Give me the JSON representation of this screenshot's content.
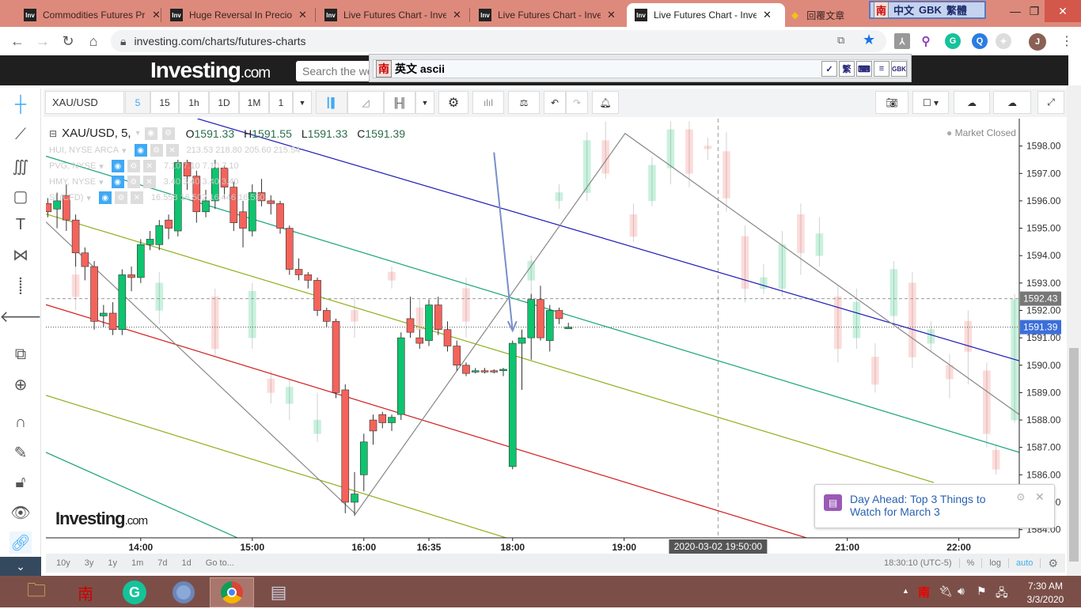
{
  "browser": {
    "tabs": [
      {
        "title": "Commodities Futures Prices",
        "favicon": "Inv"
      },
      {
        "title": "Huge Reversal In Precious",
        "favicon": "Inv"
      },
      {
        "title": "Live Futures Chart - Investing",
        "favicon": "Inv"
      },
      {
        "title": "Live Futures Chart - Investing",
        "favicon": "Inv"
      },
      {
        "title": "Live Futures Chart - Investing",
        "favicon": "Inv",
        "active": true
      },
      {
        "title": "回覆文章",
        "favicon": "gem"
      }
    ],
    "ime_status": {
      "logo": "南",
      "mode": "中文",
      "charset": "GBK",
      "script": "繁體"
    },
    "url": "investing.com/charts/futures-charts",
    "profile_initial": "J"
  },
  "site": {
    "logo_main": "Investing",
    "logo_suffix": ".com",
    "search_placeholder": "Search the website..."
  },
  "ime_bar": {
    "logo": "南",
    "text": "英文 ascii",
    "buttons": [
      "✓",
      "繁",
      "⌨",
      "≡",
      "GBK"
    ]
  },
  "toolbar": {
    "symbol": "XAU/USD",
    "intervals": [
      "5",
      "15",
      "1h",
      "1D",
      "1M",
      "1"
    ],
    "active_interval": "5"
  },
  "legend": {
    "main": {
      "symbol": "XAU/USD, 5,",
      "o_label": "O",
      "o": "1591.33",
      "h_label": "H",
      "h": "1591.55",
      "l_label": "L",
      "l": "1591.33",
      "c_label": "C",
      "c": "1591.39"
    },
    "overlays": [
      {
        "name": "HUI, NYSE ARCA",
        "values": "213.53  218.80  205.60  215.54"
      },
      {
        "name": "PVG, NYSE",
        "values": "7.10  7.10  7.10  7.10"
      },
      {
        "name": "HMY, NYSE",
        "values": "3.40  3.40  3.40  3.40"
      },
      {
        "name": "SI (CFD)",
        "values": "16.558  16.502  16.446  16.550"
      }
    ],
    "market_status": "Market Closed"
  },
  "chart_data": {
    "type": "candlestick",
    "x_unit": "bar index (5-min bars)",
    "xlim": [
      -0.2,
      104.5
    ],
    "ylim": [
      1583.7,
      1599.0
    ],
    "time_ticks": [
      {
        "i": 10,
        "label": "14:00"
      },
      {
        "i": 22,
        "label": "15:00"
      },
      {
        "i": 34,
        "label": "16:00"
      },
      {
        "i": 41,
        "label": "16:35"
      },
      {
        "i": 50,
        "label": "18:00"
      },
      {
        "i": 62,
        "label": "19:00"
      },
      {
        "i": 86,
        "label": "21:00"
      },
      {
        "i": 98,
        "label": "22:00"
      }
    ],
    "price_ticks": [
      1584,
      1585,
      1586,
      1587,
      1588,
      1589,
      1590,
      1591,
      1592,
      1593,
      1594,
      1595,
      1596,
      1597,
      1598
    ],
    "crosshair": {
      "i": 72.1,
      "label": "2020-03-02 19:50:00"
    },
    "price_labels": [
      {
        "value": 1592.43,
        "label": "1592.43",
        "style": "dashed"
      },
      {
        "value": 1591.39,
        "label": "1591.39",
        "style": "current"
      }
    ],
    "colors": {
      "up": "#0ec46e",
      "down": "#f4635b",
      "blue": "#1b1bb5",
      "teal": "#17a37a",
      "olive": "#8db01b",
      "red": "#d01c1c",
      "gray": "#888888",
      "arrow": "#7a8fc9"
    },
    "candles": [
      [
        0,
        1595.9,
        1595.6,
        1596.1,
        1595.4
      ],
      [
        1,
        1595.7,
        1596.0,
        1596.3,
        1595.0
      ],
      [
        2,
        1596.2,
        1595.3,
        1596.6,
        1594.9
      ],
      [
        3,
        1595.3,
        1594.1,
        1595.5,
        1593.6
      ],
      [
        4,
        1594.1,
        1593.6,
        1594.3,
        1593.1
      ],
      [
        5,
        1593.6,
        1591.6,
        1593.8,
        1591.3
      ],
      [
        6,
        1591.8,
        1591.9,
        1592.2,
        1591.4
      ],
      [
        7,
        1591.9,
        1591.3,
        1592.3,
        1591.1
      ],
      [
        8,
        1591.3,
        1593.3,
        1593.5,
        1591.1
      ],
      [
        9,
        1593.3,
        1593.2,
        1593.6,
        1592.7
      ],
      [
        10,
        1593.2,
        1594.4,
        1594.6,
        1593.0
      ],
      [
        11,
        1594.4,
        1594.6,
        1594.9,
        1594.2
      ],
      [
        12,
        1594.4,
        1595.1,
        1595.3,
        1594.2
      ],
      [
        13,
        1595.3,
        1595.0,
        1595.5,
        1594.6
      ],
      [
        14,
        1594.9,
        1597.4,
        1597.5,
        1594.7
      ],
      [
        15,
        1597.4,
        1596.9,
        1597.5,
        1596.4
      ],
      [
        16,
        1596.9,
        1595.6,
        1597.1,
        1595.2
      ],
      [
        17,
        1595.6,
        1596.0,
        1596.4,
        1595.4
      ],
      [
        18,
        1596.0,
        1597.2,
        1597.5,
        1595.7
      ],
      [
        19,
        1597.2,
        1596.5,
        1597.3,
        1596.1
      ],
      [
        20,
        1596.5,
        1595.2,
        1596.7,
        1594.9
      ],
      [
        21,
        1595.6,
        1595.0,
        1596.0,
        1594.3
      ],
      [
        22,
        1594.9,
        1596.3,
        1596.6,
        1594.7
      ],
      [
        23,
        1596.3,
        1596.0,
        1596.8,
        1595.8
      ],
      [
        24,
        1596.0,
        1595.9,
        1596.2,
        1595.5
      ],
      [
        25,
        1595.9,
        1595.0,
        1596.0,
        1594.8
      ],
      [
        26,
        1595.0,
        1593.5,
        1595.1,
        1593.3
      ],
      [
        27,
        1593.5,
        1593.3,
        1593.9,
        1593.1
      ],
      [
        28,
        1593.3,
        1593.1,
        1593.4,
        1592.8
      ],
      [
        29,
        1593.1,
        1592.0,
        1593.2,
        1591.8
      ],
      [
        30,
        1592.0,
        1591.6,
        1592.1,
        1591.4
      ],
      [
        31,
        1591.6,
        1589.0,
        1591.7,
        1588.8
      ],
      [
        32,
        1589.1,
        1585.0,
        1589.3,
        1584.6
      ],
      [
        33,
        1585.0,
        1585.3,
        1586.1,
        1584.5
      ],
      [
        34,
        1586.0,
        1587.2,
        1587.5,
        1585.4
      ],
      [
        35,
        1588.0,
        1587.6,
        1588.2,
        1587.1
      ],
      [
        36,
        1588.2,
        1587.9,
        1588.3,
        1587.7
      ],
      [
        37,
        1587.9,
        1588.1,
        1588.2,
        1587.6
      ],
      [
        38,
        1588.2,
        1591.0,
        1591.2,
        1588.0
      ],
      [
        39,
        1591.7,
        1591.2,
        1592.5,
        1591.0
      ],
      [
        40,
        1591.0,
        1590.8,
        1591.3,
        1590.6
      ],
      [
        41,
        1590.9,
        1592.2,
        1592.4,
        1590.7
      ],
      [
        42,
        1592.2,
        1591.3,
        1592.5,
        1591.1
      ],
      [
        43,
        1591.3,
        1590.7,
        1591.6,
        1590.5
      ],
      [
        44,
        1590.7,
        1590.0,
        1590.9,
        1589.8
      ],
      [
        45,
        1590.0,
        1589.7,
        1590.1,
        1589.6
      ],
      [
        46,
        1589.75,
        1589.8,
        1589.9,
        1589.7
      ],
      [
        47,
        1589.8,
        1589.75,
        1589.9,
        1589.7
      ],
      [
        48,
        1589.8,
        1589.75,
        1589.85,
        1589.7
      ],
      [
        49,
        1589.8,
        1589.85,
        1589.9,
        1589.6
      ],
      [
        50,
        1586.3,
        1590.8,
        1590.9,
        1586.2
      ],
      [
        51,
        1590.8,
        1591.0,
        1591.3,
        1589.1
      ],
      [
        52,
        1591.0,
        1592.4,
        1592.6,
        1590.2
      ],
      [
        53,
        1592.4,
        1591.0,
        1592.9,
        1590.9
      ],
      [
        54,
        1590.9,
        1592.0,
        1592.2,
        1590.5
      ],
      [
        55,
        1592.0,
        1591.7,
        1592.1,
        1591.5
      ],
      [
        56,
        1591.33,
        1591.39,
        1591.55,
        1591.33
      ]
    ],
    "ghost_candles": [
      [
        3,
        1593.3,
        1592.5,
        1593.9,
        1592.0
      ],
      [
        12,
        1592.0,
        1593.0,
        1593.4,
        1591.5
      ],
      [
        18,
        1592.5,
        1590.6,
        1592.8,
        1590.3
      ],
      [
        22,
        1591.0,
        1592.7,
        1593.0,
        1590.6
      ],
      [
        24,
        1589.5,
        1589.0,
        1589.8,
        1588.6
      ],
      [
        26,
        1588.6,
        1589.2,
        1589.5,
        1588.0
      ],
      [
        29,
        1587.5,
        1588.0,
        1589.0,
        1587.2
      ],
      [
        33,
        1592.0,
        1591.6,
        1592.5,
        1591.0
      ],
      [
        37,
        1593.4,
        1593.1,
        1593.6,
        1592.8
      ],
      [
        40,
        1592.1,
        1591.3,
        1592.4,
        1591.0
      ],
      [
        45,
        1592.8,
        1591.6,
        1593.2,
        1591.0
      ],
      [
        52,
        1593.1,
        1593.8,
        1594.0,
        1592.4
      ],
      [
        55,
        1596.0,
        1596.3,
        1596.6,
        1595.7
      ],
      [
        58,
        1596.3,
        1598.2,
        1598.5,
        1596.0
      ],
      [
        60,
        1598.2,
        1597.0,
        1598.9,
        1596.8
      ],
      [
        63,
        1595.5,
        1594.7,
        1595.9,
        1594.5
      ],
      [
        65,
        1596.0,
        1597.3,
        1597.6,
        1595.8
      ],
      [
        67,
        1597.2,
        1598.6,
        1598.9,
        1596.6
      ],
      [
        69,
        1598.6,
        1597.0,
        1598.9,
        1596.5
      ],
      [
        71,
        1598.0,
        1597.9,
        1598.3,
        1597.5
      ],
      [
        73,
        1597.8,
        1596.1,
        1598.5,
        1595.6
      ],
      [
        75,
        1594.7,
        1592.8,
        1595.1,
        1592.3
      ],
      [
        77,
        1592.8,
        1593.2,
        1593.7,
        1592.6
      ],
      [
        79,
        1592.8,
        1594.4,
        1594.9,
        1592.5
      ],
      [
        81,
        1595.5,
        1594.1,
        1595.9,
        1593.3
      ],
      [
        83,
        1594.0,
        1594.8,
        1595.4,
        1593.6
      ],
      [
        85,
        1592.5,
        1590.6,
        1592.9,
        1590.1
      ],
      [
        87,
        1591.0,
        1592.3,
        1592.8,
        1590.6
      ],
      [
        89,
        1590.3,
        1589.3,
        1590.8,
        1589.0
      ],
      [
        91,
        1591.8,
        1593.5,
        1593.8,
        1591.5
      ],
      [
        93,
        1593.0,
        1590.3,
        1593.4,
        1589.9
      ],
      [
        95,
        1590.8,
        1591.3,
        1591.6,
        1590.5
      ],
      [
        97,
        1590.0,
        1589.5,
        1590.4,
        1588.8
      ],
      [
        99,
        1591.6,
        1590.5,
        1592.0,
        1589.3
      ],
      [
        101,
        1589.8,
        1587.5,
        1590.1,
        1587.0
      ],
      [
        102,
        1586.9,
        1586.2,
        1587.1,
        1586.0
      ],
      [
        104,
        1588.0,
        1592.4,
        1592.6,
        1587.9
      ]
    ],
    "lines": [
      {
        "name": "blue-trendline",
        "color": "blue",
        "pts": [
          [
            16.1,
            1599.0
          ],
          [
            104.5,
            1590.16
          ]
        ]
      },
      {
        "name": "teal-upper-channel",
        "color": "teal",
        "pts": [
          [
            -0.2,
            1597.63
          ],
          [
            104.5,
            1586.82
          ]
        ]
      },
      {
        "name": "olive-upper-channel",
        "color": "olive",
        "pts": [
          [
            -0.2,
            1595.52
          ],
          [
            95.3,
            1585.72
          ]
        ]
      },
      {
        "name": "red-channel",
        "color": "red",
        "pts": [
          [
            -0.2,
            1592.21
          ],
          [
            81.6,
            1583.7
          ]
        ]
      },
      {
        "name": "olive-lower-channel",
        "color": "olive",
        "pts": [
          [
            -0.2,
            1588.9
          ],
          [
            49.3,
            1583.7
          ]
        ]
      },
      {
        "name": "teal-lower-channel",
        "color": "teal",
        "pts": [
          [
            -0.2,
            1586.82
          ],
          [
            20.4,
            1583.7
          ]
        ]
      },
      {
        "name": "gray-zigzag",
        "color": "gray",
        "pts": [
          [
            -0.2,
            1595.23
          ],
          [
            33.1,
            1584.57
          ],
          [
            62.1,
            1598.46
          ],
          [
            104.5,
            1588.2
          ]
        ]
      }
    ],
    "arrow": {
      "color": "arrow",
      "from": [
        48,
        1597.77
      ],
      "to": [
        50,
        1591.26
      ]
    }
  },
  "watermark": {
    "main": "Investing",
    "suffix": ".com"
  },
  "popup": {
    "title": "Day Ahead: Top 3 Things to Watch for March 3"
  },
  "bottom": {
    "ranges": [
      "10y",
      "3y",
      "1y",
      "1m",
      "7d",
      "1d",
      "Go to..."
    ],
    "clock": "18:30:10 (UTC-5)",
    "pct": "%",
    "log": "log",
    "auto": "auto"
  },
  "taskbar": {
    "time": "7:30 AM",
    "date": "3/3/2020",
    "ime": "南"
  }
}
